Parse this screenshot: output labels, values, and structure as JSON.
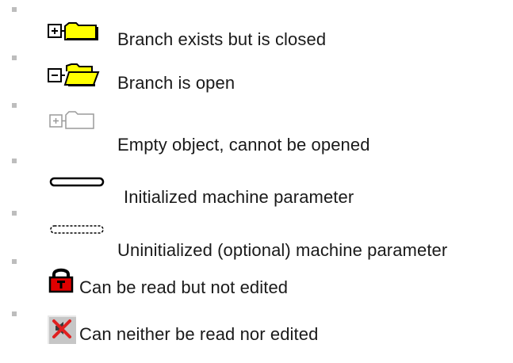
{
  "legend": {
    "items": [
      {
        "icon": "branch-closed-folder-icon",
        "label": "Branch exists but is closed"
      },
      {
        "icon": "branch-open-folder-icon",
        "label": "Branch is open"
      },
      {
        "icon": "empty-object-folder-icon",
        "label": "Empty object, cannot be opened"
      },
      {
        "icon": "initialized-parameter-icon",
        "label": "Initialized machine parameter"
      },
      {
        "icon": "uninitialized-parameter-icon",
        "label": "Uninitialized (optional) machine parameter"
      },
      {
        "icon": "lock-icon",
        "label": "Can be read but not edited"
      },
      {
        "icon": "no-access-icon",
        "label": "Can neither be read nor edited"
      }
    ]
  },
  "colors": {
    "folder_yellow": "#ffff00",
    "lock_red": "#e00000",
    "no_access_red": "#e02020",
    "bullet_gray": "#bdbdbd"
  }
}
